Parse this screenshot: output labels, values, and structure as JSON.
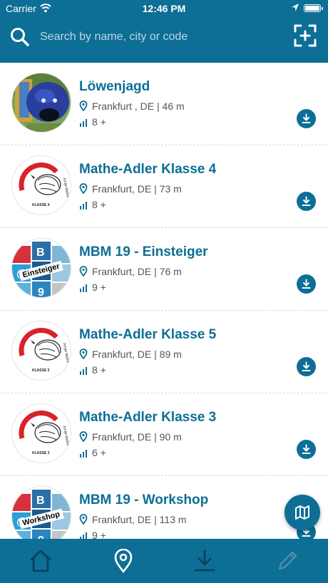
{
  "status_bar": {
    "carrier": "Carrier",
    "time": "12:46 PM"
  },
  "search": {
    "placeholder": "Search by name, city or code"
  },
  "colors": {
    "primary": "#0d6e96",
    "text_secondary": "#555555",
    "inactive_tab": "#4f8fab"
  },
  "trails": [
    {
      "title": "Löwenjagd",
      "location": "Frankfurt , DE | 46 m",
      "age": "8 +",
      "image": "lion-photo"
    },
    {
      "title": "Mathe-Adler Klasse 4",
      "location": "Frankfurt, DE | 73 m",
      "age": "8 +",
      "image": "eagle-logo",
      "badge": "KLASSE 4"
    },
    {
      "title": "MBM 19 - Einsteiger",
      "location": "Frankfurt, DE | 76 m",
      "age": "9 +",
      "image": "mbm-logo",
      "badge": "Einsteiger"
    },
    {
      "title": "Mathe-Adler Klasse 5",
      "location": "Frankfurt, DE | 89 m",
      "age": "8 +",
      "image": "eagle-logo",
      "badge": "KLASSE 5"
    },
    {
      "title": "Mathe-Adler Klasse 3",
      "location": "Frankfurt, DE | 90 m",
      "age": "6 +",
      "image": "eagle-logo",
      "badge": "KLASSE 3"
    },
    {
      "title": "MBM 19 - Workshop",
      "location": "Frankfurt, DE | 113 m",
      "age": "9 +",
      "image": "mbm-logo",
      "badge": "Workshop"
    }
  ],
  "tabs": [
    {
      "name": "home",
      "icon": "home-icon",
      "active": false
    },
    {
      "name": "nearby",
      "icon": "map-pin-icon",
      "active": true
    },
    {
      "name": "downloads",
      "icon": "download-icon",
      "active": false
    },
    {
      "name": "create",
      "icon": "pencil-icon",
      "active": false
    }
  ]
}
